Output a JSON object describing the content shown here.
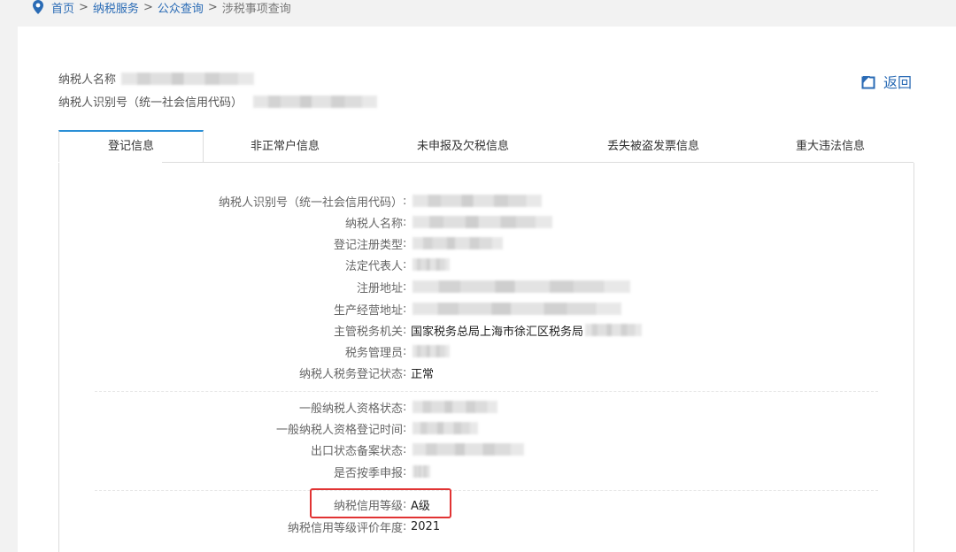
{
  "breadcrumb": {
    "items": [
      "首页",
      "纳税服务",
      "公众查询",
      "涉税事项查询"
    ],
    "separator": ">"
  },
  "taxpayer": {
    "name_label": "纳税人名称",
    "id_label": "纳税人识别号（统一社会信用代码）"
  },
  "back": {
    "label": "返回"
  },
  "tabs": [
    {
      "label": "登记信息"
    },
    {
      "label": "非正常户信息"
    },
    {
      "label": "未申报及欠税信息"
    },
    {
      "label": "丢失被盗发票信息"
    },
    {
      "label": "重大违法信息"
    }
  ],
  "fields": [
    {
      "label": "纳税人识别号（统一社会信用代码）",
      "value": ""
    },
    {
      "label": "纳税人名称",
      "value": ""
    },
    {
      "label": "登记注册类型",
      "value": ""
    },
    {
      "label": "法定代表人",
      "value": ""
    },
    {
      "label": "注册地址",
      "value": ""
    },
    {
      "label": "生产经营地址",
      "value": ""
    },
    {
      "label": "主管税务机关",
      "value": "国家税务总局上海市徐汇区税务局"
    },
    {
      "label": "税务管理员",
      "value": ""
    },
    {
      "label": "纳税人税务登记状态",
      "value": "正常"
    },
    {
      "label": "一般纳税人资格状态",
      "value": ""
    },
    {
      "label": "一般纳税人资格登记时间",
      "value": ""
    },
    {
      "label": "出口状态备案状态",
      "value": ""
    },
    {
      "label": "是否按季申报",
      "value": ""
    },
    {
      "label": "纳税信用等级",
      "value": "A级"
    },
    {
      "label": "纳税信用等级评价年度",
      "value": "2021"
    }
  ],
  "colors": {
    "link": "#2a6bb5",
    "tab_accent": "#2a8fd6",
    "highlight": "#e13333"
  }
}
